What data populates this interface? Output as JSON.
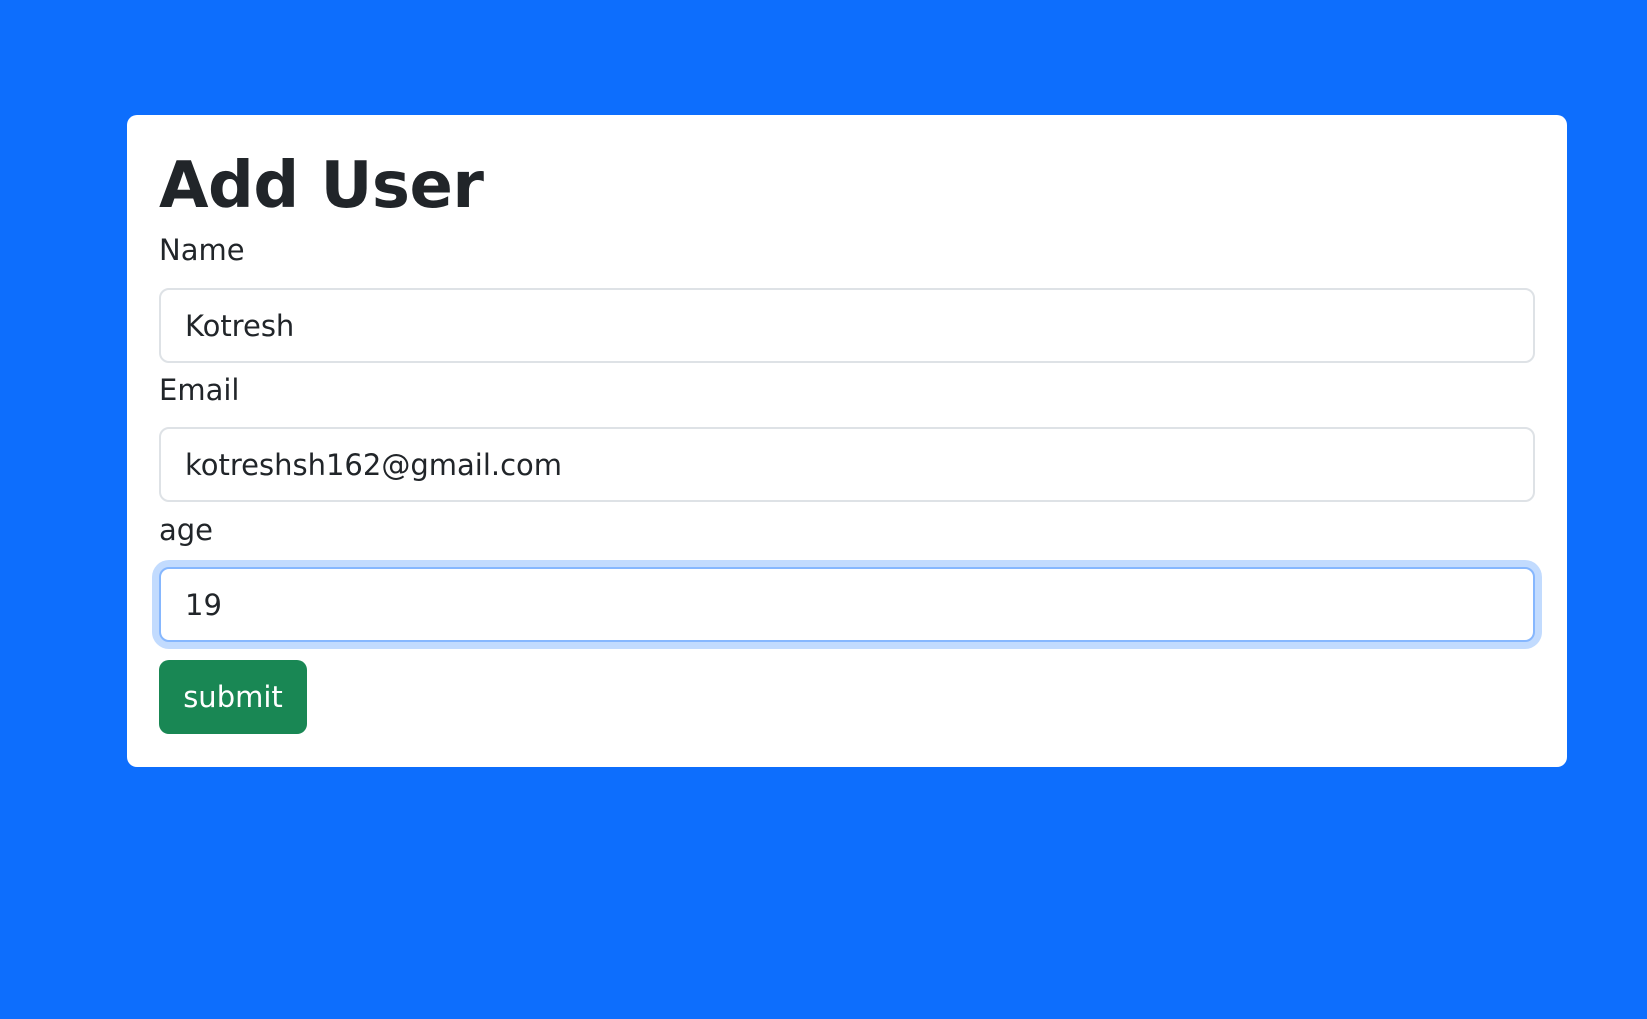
{
  "form": {
    "title": "Add User",
    "name_label": "Name",
    "name_value": "Kotresh",
    "email_label": "Email",
    "email_value": "kotreshsh162@gmail.com",
    "age_label": "age",
    "age_value": "19",
    "submit_label": "submit"
  },
  "colors": {
    "background": "#0d6efd",
    "submit": "#198754"
  }
}
